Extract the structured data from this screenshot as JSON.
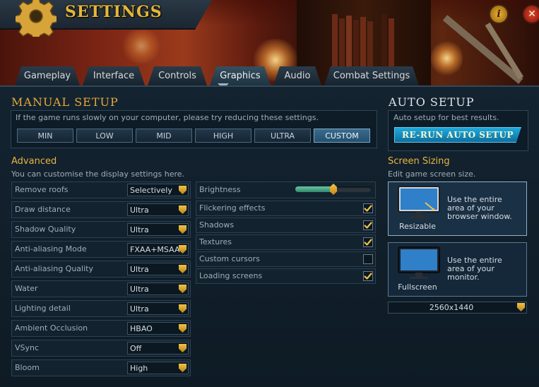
{
  "window": {
    "title": "SETTINGS"
  },
  "tabs": [
    {
      "label": "Gameplay",
      "active": false
    },
    {
      "label": "Interface",
      "active": false
    },
    {
      "label": "Controls",
      "active": false
    },
    {
      "label": "Graphics",
      "active": true
    },
    {
      "label": "Audio",
      "active": false
    },
    {
      "label": "Combat Settings",
      "active": false
    }
  ],
  "manual_setup": {
    "title": "MANUAL SETUP",
    "hint": "If the game runs slowly on your computer, please try reducing these settings.",
    "presets": [
      "MIN",
      "LOW",
      "MID",
      "HIGH",
      "ULTRA",
      "CUSTOM"
    ],
    "selected_preset": "CUSTOM"
  },
  "auto_setup": {
    "title": "AUTO SETUP",
    "description": "Auto setup for best results.",
    "button_label": "RE-RUN AUTO SETUP"
  },
  "advanced": {
    "title": "Advanced",
    "description": "You can customise the display settings here.",
    "dropdown_settings": [
      {
        "label": "Remove roofs",
        "value": "Selectively"
      },
      {
        "label": "Draw distance",
        "value": "Ultra"
      },
      {
        "label": "Shadow Quality",
        "value": "Ultra"
      },
      {
        "label": "Anti-aliasing Mode",
        "value": "FXAA+MSAA"
      },
      {
        "label": "Anti-aliasing Quality",
        "value": "Ultra"
      },
      {
        "label": "Water",
        "value": "Ultra"
      },
      {
        "label": "Lighting detail",
        "value": "Ultra"
      },
      {
        "label": "Ambient Occlusion",
        "value": "HBAO"
      },
      {
        "label": "VSync",
        "value": "Off"
      },
      {
        "label": "Bloom",
        "value": "High"
      }
    ],
    "brightness": {
      "label": "Brightness",
      "value_fraction": 0.5
    },
    "checkbox_settings": [
      {
        "label": "Flickering effects",
        "checked": true
      },
      {
        "label": "Shadows",
        "checked": true
      },
      {
        "label": "Textures",
        "checked": true
      },
      {
        "label": "Custom cursors",
        "checked": false
      },
      {
        "label": "Loading screens",
        "checked": true
      }
    ]
  },
  "screen_sizing": {
    "title": "Screen Sizing",
    "description": "Edit game screen size.",
    "options": [
      {
        "name": "Resizable",
        "lines": [
          "Use the entire",
          "area of your",
          "browser window."
        ],
        "selected": true
      },
      {
        "name": "Fullscreen",
        "lines": [
          "Use the entire",
          "area of your",
          "monitor."
        ],
        "selected": false
      }
    ],
    "resolution": "2560x1440"
  },
  "colors": {
    "accent_gold": "#e7b542",
    "section_title": "#e5a83a",
    "auto_title": "#dfe5ea",
    "preset_selected": "#2f5f80",
    "rerun_button": "#1a94c8"
  },
  "icons": [
    "gear-icon",
    "info-icon",
    "close-icon",
    "chevron-down-icon",
    "checkmark-icon",
    "monitor-icon"
  ]
}
